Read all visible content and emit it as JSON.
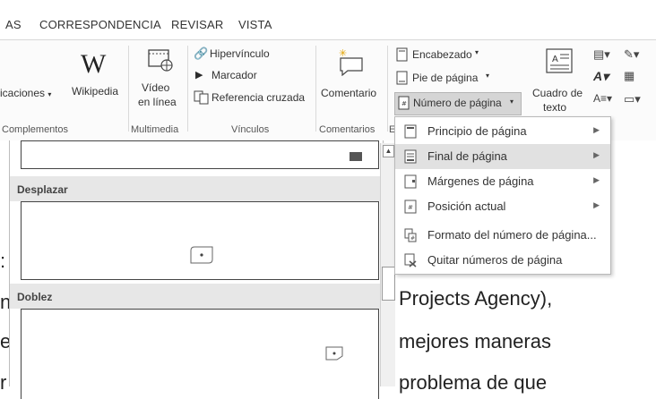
{
  "tabs": [
    "AS",
    "CORRESPONDENCIA",
    "REVISAR",
    "VISTA"
  ],
  "ribbon": {
    "complementos": {
      "aplicaciones": "icaciones",
      "wikipedia": "Wikipedia",
      "wikipedia_glyph": "W",
      "label": "Complementos"
    },
    "multimedia": {
      "video1": "Vídeo",
      "video2": "en línea",
      "label": "Multimedia"
    },
    "vinculos": {
      "hipervinculo": "Hipervínculo",
      "marcador": "Marcador",
      "referencia": "Referencia cruzada",
      "label": "Vínculos"
    },
    "comentarios": {
      "comentario": "Comentario",
      "label": "Comentarios"
    },
    "encabezado": {
      "encabezado": "Encabezado",
      "pie": "Pie de página",
      "numero": "Número de página",
      "label": "E"
    },
    "texto": {
      "cuadro1": "Cuadro de",
      "cuadro2": "texto"
    }
  },
  "gallery": {
    "section1": "Desplazar",
    "section2": "Doblez"
  },
  "menu": {
    "items": [
      {
        "label": "Principio de página",
        "submenu": true
      },
      {
        "label": "Final de página",
        "submenu": true
      },
      {
        "label": "Márgenes de página",
        "submenu": true
      },
      {
        "label": "Posición actual",
        "submenu": true
      },
      {
        "label": "Formato del número de página...",
        "submenu": false
      },
      {
        "label": "Quitar números de página",
        "submenu": false
      }
    ]
  },
  "document": {
    "line1": "Projects Agency),",
    "line2": "mejores maneras",
    "line3": "problema de que",
    "left1": ":",
    "left2": "n",
    "left3": "e",
    "left4": "r"
  },
  "colors": {
    "highlight": "#e1e1e1",
    "ribbon_bg": "#fbfbfb"
  }
}
